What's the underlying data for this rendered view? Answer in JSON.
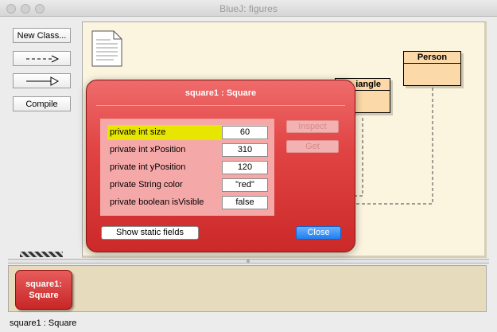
{
  "window": {
    "title": "BlueJ:  figures"
  },
  "toolbar": {
    "new_class_label": "New Class...",
    "dependency_arrow_icon": "dashed-arrow-icon",
    "inheritance_arrow_icon": "hollow-arrow-icon",
    "compile_label": "Compile"
  },
  "diagram": {
    "classes": [
      {
        "name": "Person"
      },
      {
        "name": "Triangle",
        "visible_text": "iangle"
      }
    ],
    "readme_icon": "document-icon"
  },
  "inspector": {
    "title": "square1 : Square",
    "fields": [
      {
        "label": "private int size",
        "value": "60"
      },
      {
        "label": "private int xPosition",
        "value": "310"
      },
      {
        "label": "private int yPosition",
        "value": "120"
      },
      {
        "label": "private String color",
        "value": "\"red\""
      },
      {
        "label": "private boolean isVisible",
        "value": "false"
      }
    ],
    "inspect_label": "Inspect",
    "get_label": "Get",
    "show_static_label": "Show static fields",
    "close_label": "Close",
    "colors": {
      "dialog": "#e14444",
      "selected_row": "#e6e600",
      "close_button": "#1f7ef0"
    }
  },
  "object_bench": {
    "object_line1": "square1:",
    "object_line2": "Square"
  },
  "status": {
    "text": "square1 : Square"
  }
}
